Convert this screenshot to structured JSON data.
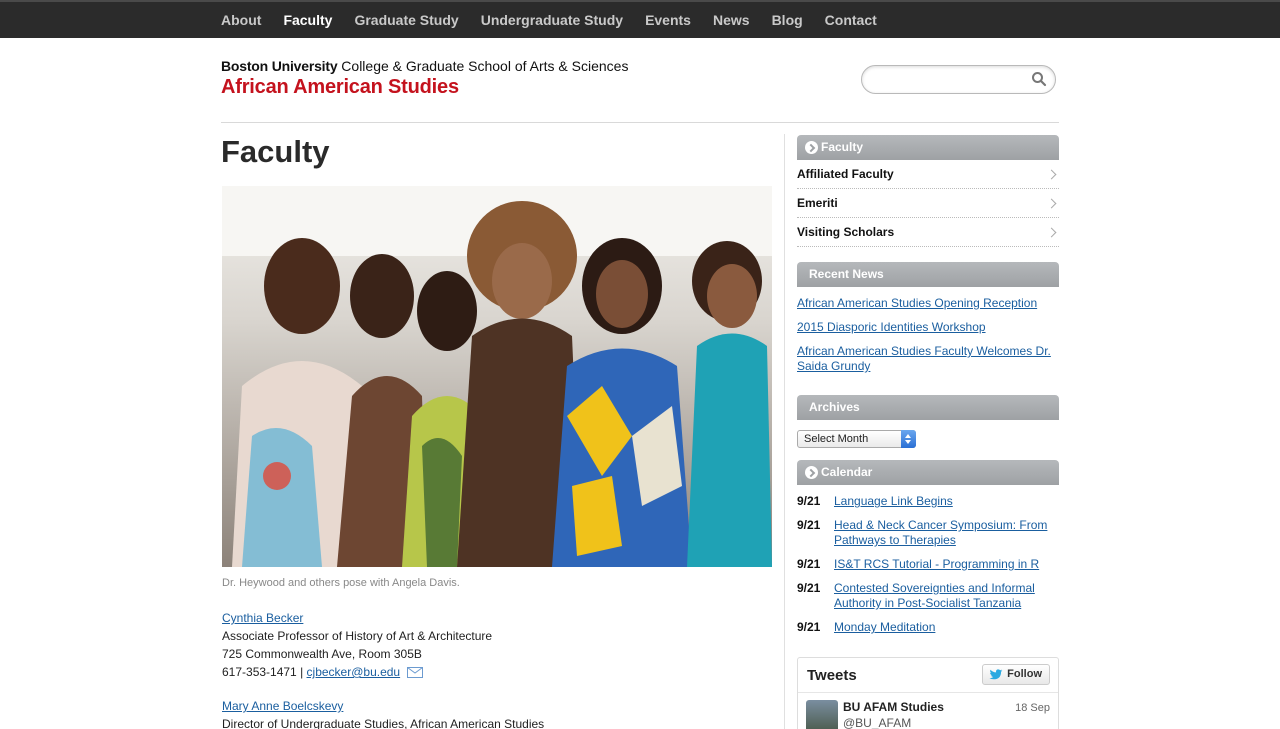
{
  "nav": {
    "items": [
      "About",
      "Faculty",
      "Graduate Study",
      "Undergraduate Study",
      "Events",
      "News",
      "Blog",
      "Contact"
    ],
    "active": "Faculty"
  },
  "header": {
    "university": "Boston University",
    "college": "College & Graduate School of Arts & Sciences",
    "department": "African American Studies",
    "search_placeholder": ""
  },
  "main": {
    "title": "Faculty",
    "photo_caption": "Dr. Heywood and others pose with Angela Davis.",
    "people": [
      {
        "name": "Cynthia Becker",
        "title": "Associate Professor of History of Art & Architecture",
        "address": "725 Commonwealth Ave, Room 305B",
        "phone": "617-353-1471 |",
        "email": "cjbecker@bu.edu"
      },
      {
        "name": "Mary Anne Boelcskevy",
        "title": "Director of Undergraduate Studies, African American Studies"
      }
    ]
  },
  "sidebar": {
    "faculty_head": "Faculty",
    "faculty_items": [
      "Affiliated Faculty",
      "Emeriti",
      "Visiting Scholars"
    ],
    "news_head": "Recent News",
    "news": [
      "African American Studies Opening Reception",
      "2015 Diasporic Identities Workshop",
      "African American Studies Faculty Welcomes Dr. Saida Grundy"
    ],
    "archives_head": "Archives",
    "archives_select": "Select Month",
    "calendar_head": "Calendar",
    "calendar": [
      {
        "date": "9/21",
        "title": "Language Link Begins"
      },
      {
        "date": "9/21",
        "title": "Head & Neck Cancer Symposium: From Pathways to Therapies"
      },
      {
        "date": "9/21",
        "title": "IS&T RCS Tutorial - Programming in R"
      },
      {
        "date": "9/21",
        "title": "Contested Sovereignties and Informal Authority in Post-Socialist Tanzania"
      },
      {
        "date": "9/21",
        "title": "Monday Meditation"
      }
    ],
    "tweets": {
      "title": "Tweets",
      "follow": "Follow",
      "name": "BU AFAM Studies",
      "handle": "@BU_AFAM",
      "date": "18 Sep"
    }
  },
  "colors": {
    "nav_bg": "#2b2b2b",
    "department_red": "#c4121d",
    "link_blue": "#1a5e9f",
    "sidebar_head": "#a7aaad"
  }
}
